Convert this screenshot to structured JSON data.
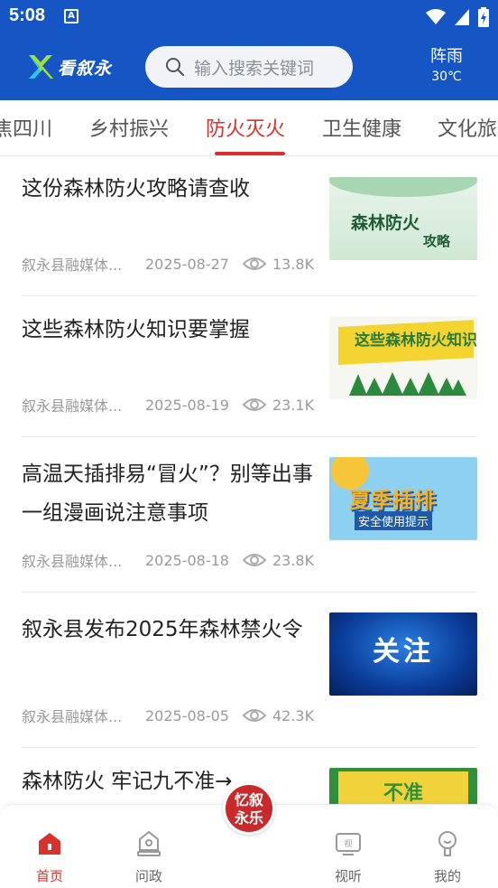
{
  "status_bar": {
    "time": "5:08",
    "notification_glyph": "A"
  },
  "header": {
    "logo_text": "看叙永",
    "search_placeholder": "输入搜索关键词",
    "weather": {
      "condition": "阵雨",
      "temperature": "30℃"
    }
  },
  "tabs": {
    "items": [
      "焦四川",
      "乡村振兴",
      "防火灭火",
      "卫生健康",
      "文化旅"
    ],
    "active_index": 2
  },
  "articles": [
    {
      "title": "这份森林防火攻略请查收",
      "source": "叙永县融媒体...",
      "date": "2025-08-27",
      "views": "13.8K",
      "thumb_text": [
        "森林防火",
        "攻略"
      ]
    },
    {
      "title": "这些森林防火知识要掌握",
      "source": "叙永县融媒体...",
      "date": "2025-08-19",
      "views": "23.1K",
      "thumb_text": [
        "这些森林防火知识"
      ]
    },
    {
      "title": "高温天插排易“冒火”？别等出事  一组漫画说注意事项",
      "source": "叙永县融媒体...",
      "date": "2025-08-18",
      "views": "23.8K",
      "thumb_text": [
        "夏季插排",
        "安全使用提示"
      ]
    },
    {
      "title": "叙永县发布2025年森林禁火令",
      "source": "叙永县融媒体...",
      "date": "2025-08-05",
      "views": "42.3K",
      "thumb_text": [
        "关注"
      ]
    },
    {
      "title": "森林防火  牢记九不准→",
      "thumb_text": [
        "不准"
      ]
    }
  ],
  "bottom_nav": {
    "items": [
      {
        "label": "首页",
        "icon": "home-icon",
        "active": true
      },
      {
        "label": "问政",
        "icon": "politics-icon",
        "active": false
      },
      {
        "label": "视听",
        "icon": "tv-icon",
        "active": false
      },
      {
        "label": "我的",
        "icon": "profile-icon",
        "active": false
      }
    ],
    "center_badge": "忆叙永乐"
  },
  "colors": {
    "brand_blue": "#1656c4",
    "accent_red": "#d9312b"
  }
}
